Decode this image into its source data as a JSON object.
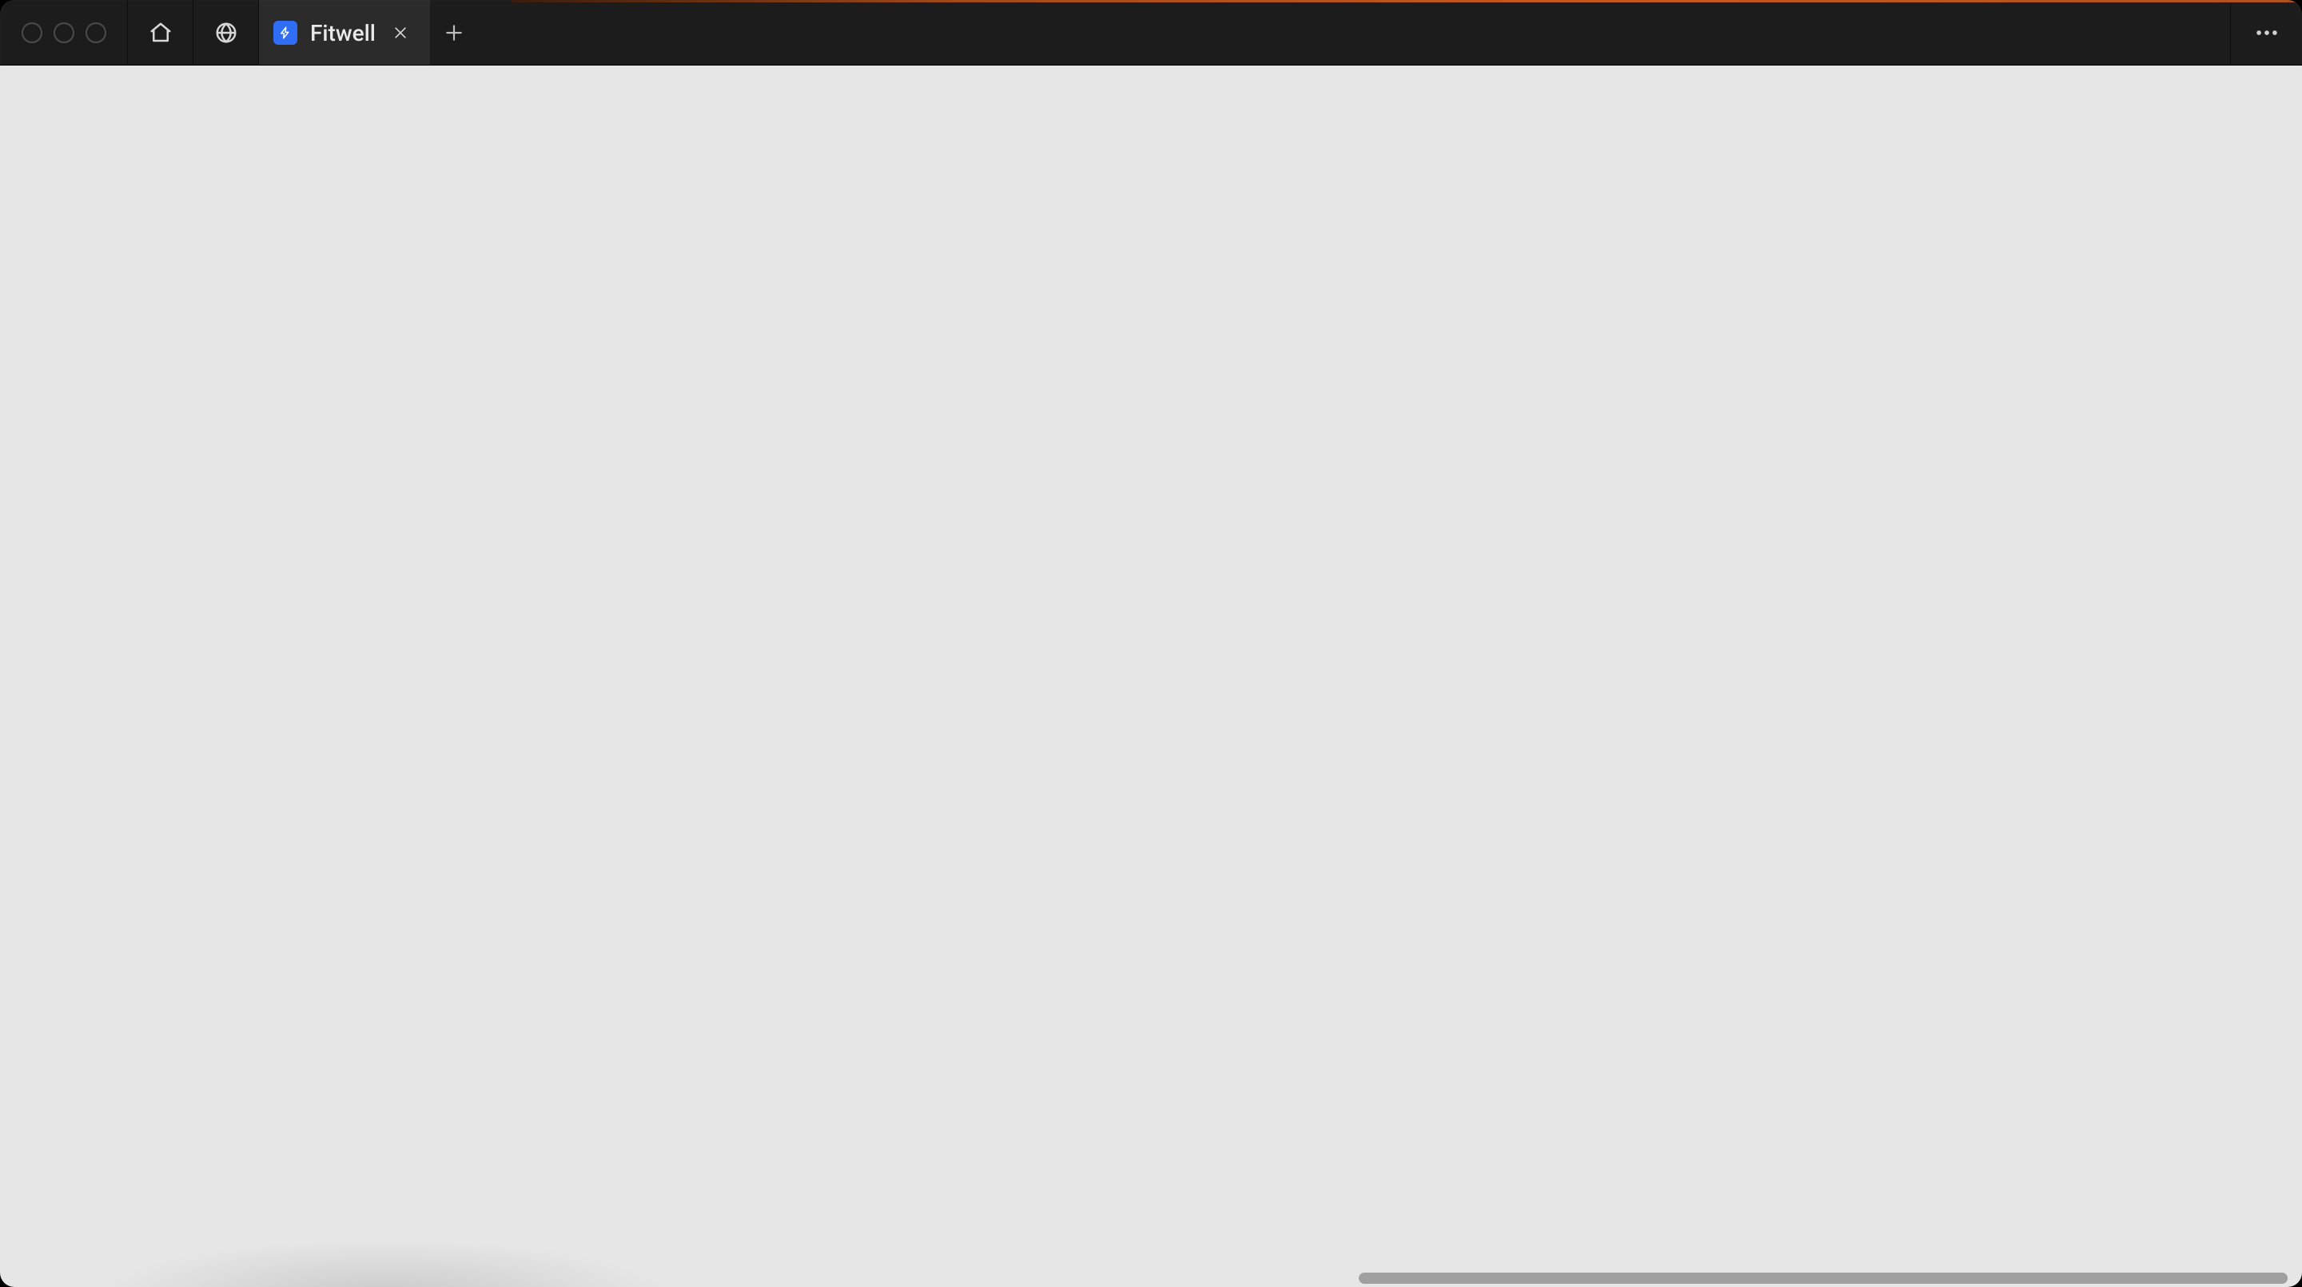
{
  "colors": {
    "chrome": "#1c1c1c",
    "tab_bg": "#2b2b2b",
    "favicon_bg": "#2f6df4",
    "page_bg": "#e6e6e6",
    "accent_loading": "#c55a1d"
  },
  "tab": {
    "title": "Fitwell"
  }
}
